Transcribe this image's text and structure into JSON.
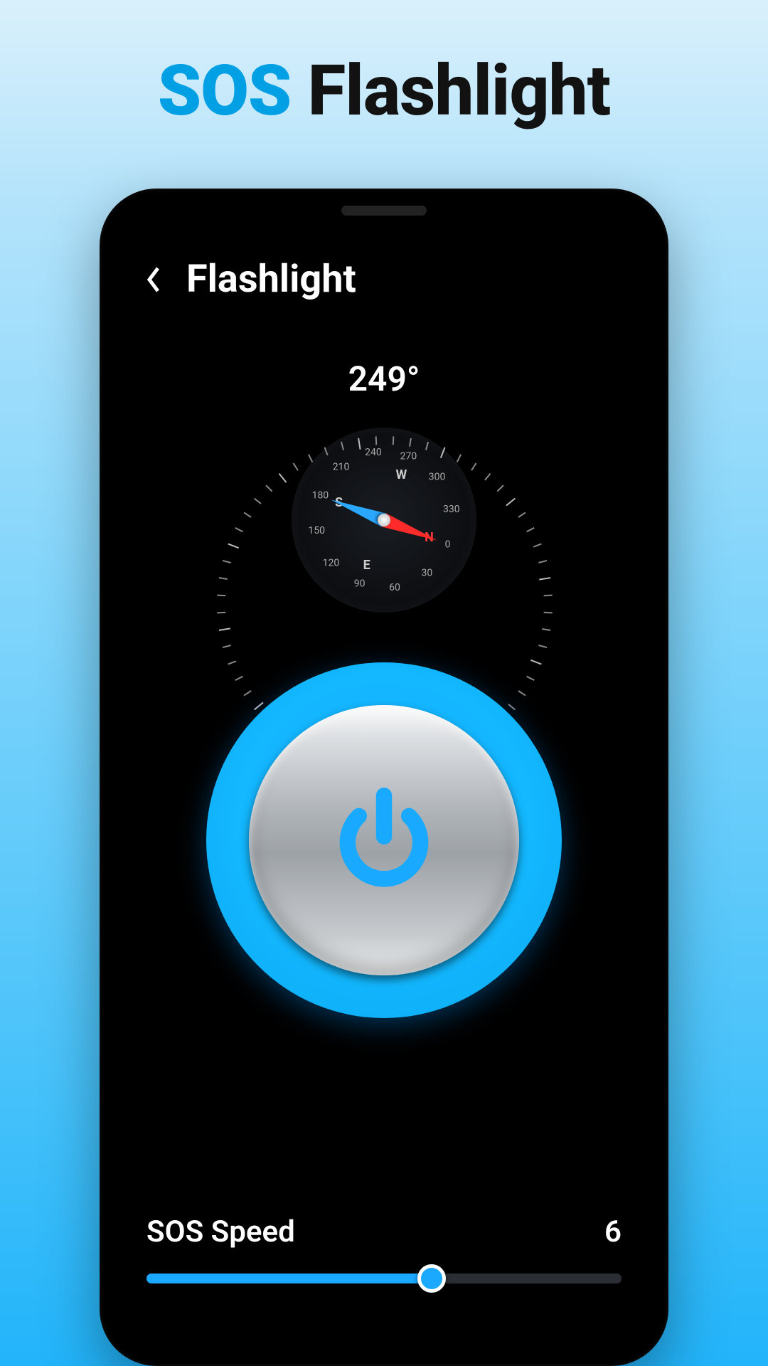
{
  "promo": {
    "accent": "SOS",
    "rest": " Flashlight"
  },
  "app": {
    "title": "Flashlight"
  },
  "compass": {
    "heading_deg": 249,
    "heading_display": "249°",
    "cardinal": [
      "N",
      "E",
      "S",
      "W"
    ],
    "deg_labels": [
      0,
      30,
      60,
      90,
      120,
      150,
      180,
      210,
      240,
      270,
      300,
      330
    ]
  },
  "power": {
    "state": "off"
  },
  "slider": {
    "label": "SOS Speed",
    "value": 6,
    "min": 0,
    "max": 10
  },
  "colors": {
    "accent": "#1aa9ff",
    "text": "#ffffff",
    "bg": "#000000"
  }
}
